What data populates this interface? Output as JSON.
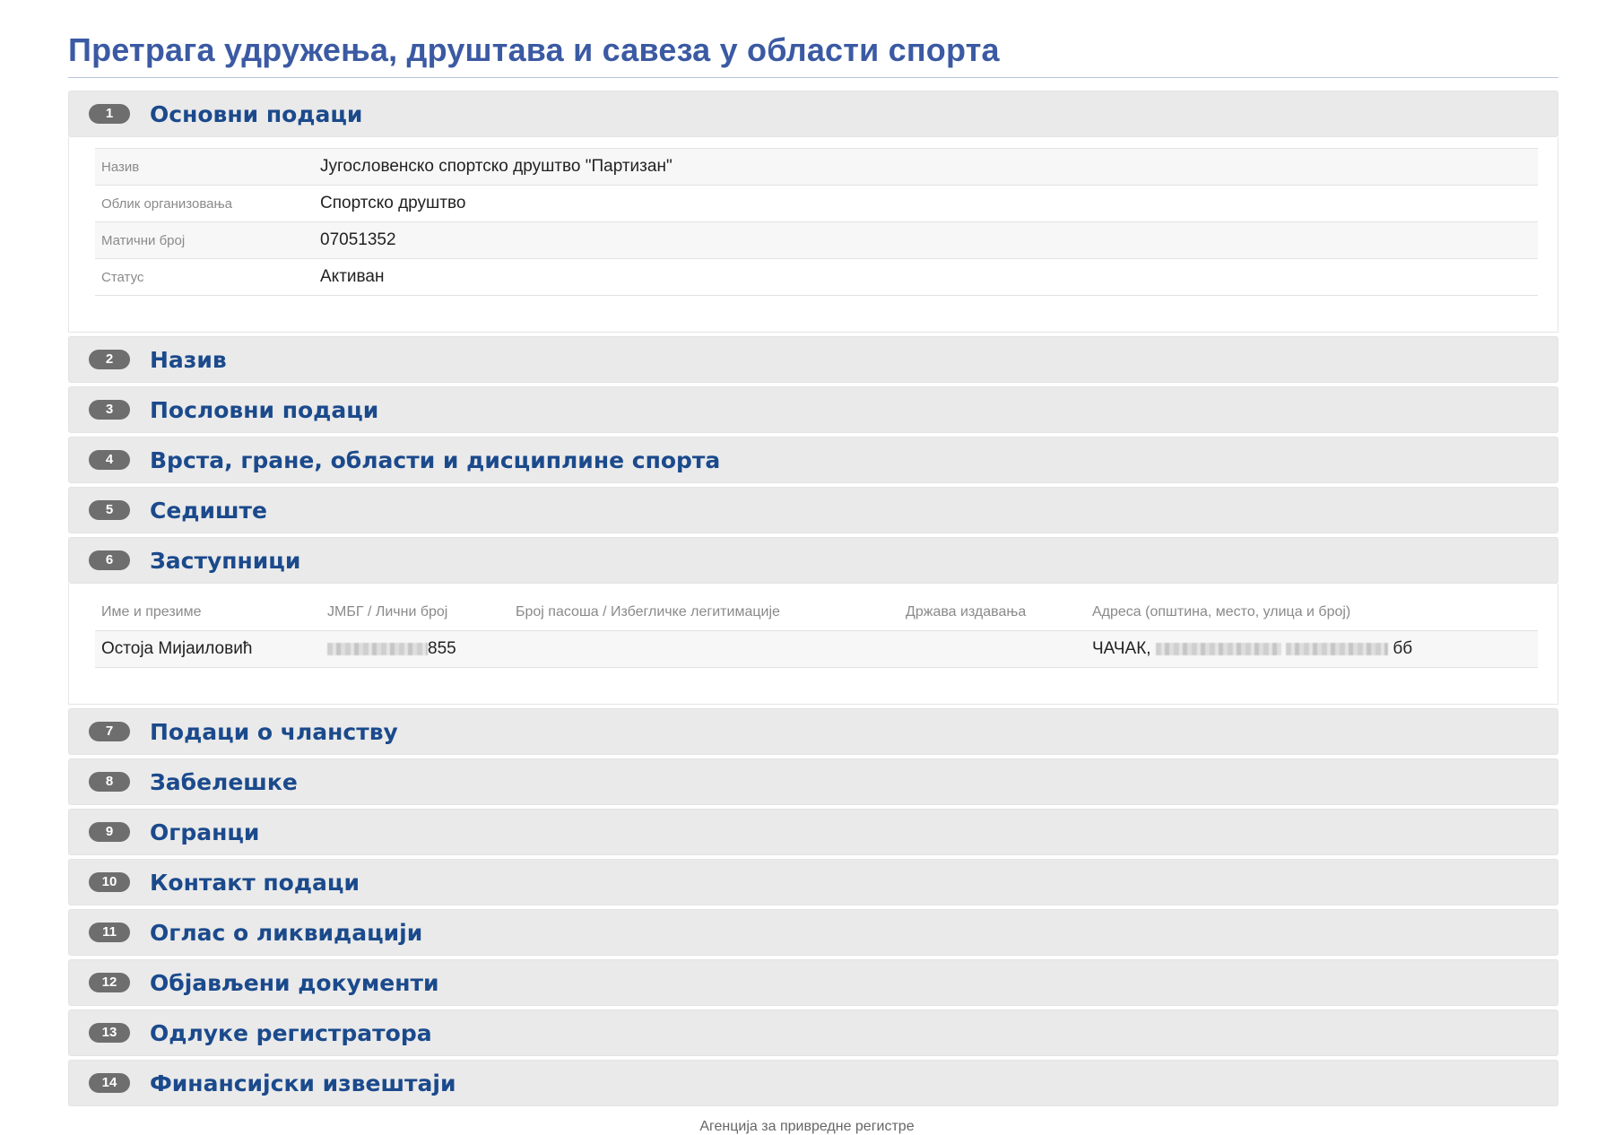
{
  "page": {
    "title": "Претрага удружења, друштава и савеза у области спорта"
  },
  "sections": [
    {
      "number": "1",
      "title": "Основни подаци"
    },
    {
      "number": "2",
      "title": "Назив"
    },
    {
      "number": "3",
      "title": "Пословни подаци"
    },
    {
      "number": "4",
      "title": "Врста, гране, области и дисциплине спорта"
    },
    {
      "number": "5",
      "title": "Седиште"
    },
    {
      "number": "6",
      "title": "Заступници"
    },
    {
      "number": "7",
      "title": "Подаци о чланству"
    },
    {
      "number": "8",
      "title": "Забелешке"
    },
    {
      "number": "9",
      "title": "Огранци"
    },
    {
      "number": "10",
      "title": "Контакт подаци"
    },
    {
      "number": "11",
      "title": "Оглас о ликвидацији"
    },
    {
      "number": "12",
      "title": "Објављени документи"
    },
    {
      "number": "13",
      "title": "Одлуке регистратора"
    },
    {
      "number": "14",
      "title": "Финансијски извештаји"
    }
  ],
  "basic_data": {
    "rows": [
      {
        "label": "Назив",
        "value": "Југословенско спортско друштво \"Партизан\""
      },
      {
        "label": "Облик организовања",
        "value": "Спортско друштво"
      },
      {
        "label": "Матични број",
        "value": "07051352"
      },
      {
        "label": "Статус",
        "value": "Активан"
      }
    ]
  },
  "representatives": {
    "columns": [
      "Име и презиме",
      "ЈМБГ / Лични број",
      "Број пасоша / Избегличке легитимације",
      "Држава издавања",
      "Адреса (општина, место, улица и број)"
    ],
    "rows": [
      {
        "name": "Остоја Мијаиловић",
        "jmbg_suffix": "855",
        "passport": "",
        "country": "",
        "address_prefix": "ЧАЧАК,",
        "address_suffix": "бб"
      }
    ]
  },
  "footer": {
    "text": "Агенција за привредне регистре"
  }
}
